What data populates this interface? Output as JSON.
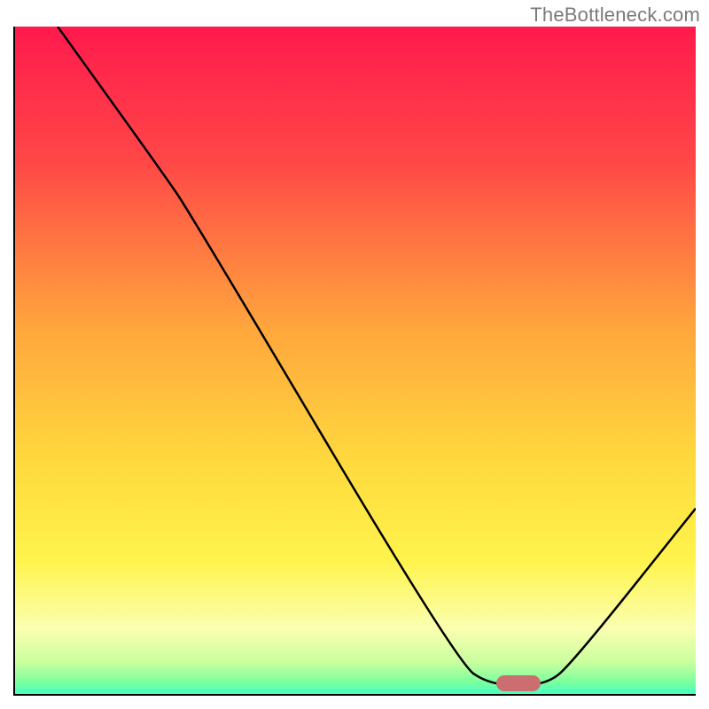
{
  "watermark": "TheBottleneck.com",
  "chart_data": {
    "type": "line",
    "title": "",
    "xlabel": "",
    "ylabel": "",
    "xlim": [
      0,
      100
    ],
    "ylim": [
      0,
      100
    ],
    "gradient_stops": [
      {
        "pos": 0,
        "color": "#ff1a4d"
      },
      {
        "pos": 20,
        "color": "#ff4747"
      },
      {
        "pos": 45,
        "color": "#ffa63d"
      },
      {
        "pos": 65,
        "color": "#ffd93d"
      },
      {
        "pos": 80,
        "color": "#fff44d"
      },
      {
        "pos": 90,
        "color": "#faffb0"
      },
      {
        "pos": 95,
        "color": "#c9ff9e"
      },
      {
        "pos": 98,
        "color": "#7aff9e"
      },
      {
        "pos": 100,
        "color": "#3dffc9"
      }
    ],
    "series": [
      {
        "name": "bottleneck-curve",
        "points": [
          {
            "x": 6.5,
            "y": 100
          },
          {
            "x": 22,
            "y": 78
          },
          {
            "x": 26,
            "y": 72
          },
          {
            "x": 65,
            "y": 5
          },
          {
            "x": 70,
            "y": 1.5
          },
          {
            "x": 78,
            "y": 1.5
          },
          {
            "x": 82,
            "y": 5
          },
          {
            "x": 100,
            "y": 28
          }
        ]
      }
    ],
    "marker": {
      "x": 74,
      "y": 1.8,
      "color": "#cc6d6f"
    }
  }
}
